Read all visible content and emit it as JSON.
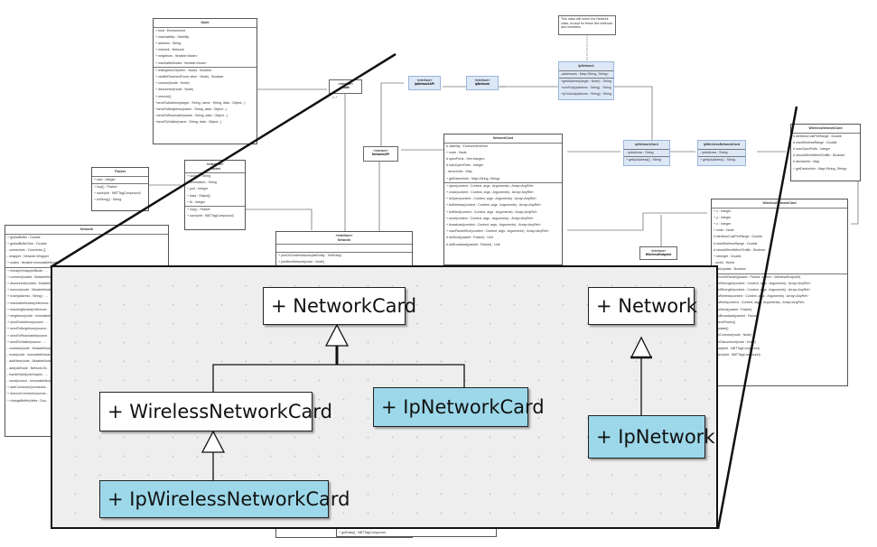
{
  "diagram": {
    "note": "This class will mirror the Network class, except for these few methods and members",
    "node": {
      "name": "Node",
      "attributes": [
        "+ host : Environment",
        "+ reachability : Visibility",
        "+ address : String",
        "+ network : Network",
        "+ neighbors : Iterable<Node>",
        "+ reachableNodes : Iterable<Node>"
      ],
      "methods": [
        "+ isNeighborOf(other : Node) : Boolean",
        "+ canBeReachedFrom( other : Node) : Boolean",
        "+ connect(node : Node)",
        "+ disconnect(node : Node)",
        "+ remove()",
        "+sendToAddress(target : String, name : String, data : Object...)",
        "+sendToNeighbors(name : String, data : Object...)",
        "+sendToReachable(name : String, data : Object...)",
        "+sendToVisible(name : String, data : Object...)"
      ]
    },
    "iface_node": {
      "stereotype": "«interface»",
      "name": "Node",
      "multiplicity": "1..*"
    },
    "ip_network_api": {
      "stereotype": "«interface»",
      "name": "IpNetworkAPI"
    },
    "ip_network_iface": {
      "stereotype": "«interface»",
      "name": "IpNetwork"
    },
    "network_api": {
      "stereotype": "«interface»",
      "name": "NetworkAPI"
    },
    "wireless_endpoint": {
      "stereotype": "«interface»",
      "name": "WirelessEndpoint"
    },
    "ip_network": {
      "name": "IpNetwork",
      "attributes": [
        "-addresses : Map<String, String>"
      ],
      "methods": [
        "+getAddress(target : Node) : String",
        "+uuidToIp(address : String) : String",
        "+ipToUuid(address : String) : String"
      ]
    },
    "network_card": {
      "name": "NetworkCard",
      "attributes": [
        "# visibility : EnvironmentHost",
        "+ node : Node",
        "# openPorts : Set<Integer>",
        "# maxOpenPorts : Integer",
        "- deviceInfo : Map",
        "+ getDeviceInfo : Map<String, String>"
      ],
      "methods": [
        "+ open(context : Context, args : Arguments) : Array<AnyRef>",
        "+ close(context : Context, args : Arguments) : Array<AnyRef>",
        "+ isOpen(context : Context, args : Arguments) : Array<AnyRef>",
        "+ isWireless(context : Context, args : Arguments) : Array<AnyRef>",
        "+ isWired(context : Context, args : Arguments) : Array<AnyRef>",
        "+ send(context : Context, args : Arguments) : Array<AnyRef>",
        "+ broadcast(context : Context, args : Arguments) : Array<AnyRef>",
        "+ maxPacketSize(context : Context, args : Arguments) : Array<AnyRef>",
        "# doSend(packet : Packet) : Unit",
        "# doBroadcast(packet : Packet) : Unit"
      ]
    },
    "ip_network_card": {
      "name": "IpNetworkCard",
      "attributes": [
        "- ipAddress : String"
      ],
      "methods": [
        "+ getIpAddress() : String"
      ]
    },
    "ip_wireless_network_card": {
      "name": "IpWirelessNetworkCard",
      "attributes": [
        "- ipAddress : String"
      ],
      "methods": [
        "+ getIpAddress() : String"
      ]
    },
    "wireless_network_card_small": {
      "name": "WirelessNetworkCard",
      "attributes": [
        "# wirelessCostPerRange : Double",
        "# maxWirelessRange : Double",
        "# maxOpenPorts : Integer",
        "# shouldSendWiredTraffic : Boolean",
        "# deviceInfo : Map",
        "+ getDeviceInfo : Map<String, String>"
      ]
    },
    "wireless_network_card": {
      "name": "WirelessNetworkCard",
      "attributes": [
        "+ x : Integer",
        "+ y : Integer",
        "+ z : Integer",
        "+ node : Node",
        "# wirelessCostPerRange : Double",
        "# maxWirelessRange : Double",
        "# shouldSendWiredTraffic : Boolean",
        "+ strength : Double",
        "- world : World",
        "- canUpdate : Boolean"
      ],
      "methods": [
        "+ receivePacket(packet : Packet, source : WirelessEndpoint)",
        "+ getStrength(context : Context, args : Arguments) : Array<AnyRef>",
        "+ setStrength(context : Context, args : Arguments) : Array<AnyRef>",
        "+ isWireless(context : Context, args : Arguments) : Array<AnyRef>",
        "+ isWired(context : Context, args : Arguments) : Array<AnyRef>",
        "# doSend(packet : Packet)",
        "# doBroadcast(packet : Packet)",
        "- checkPower()",
        "+ update()",
        "+ onConnect(node : Node)",
        "+ onDisconnect(node : Node)",
        "+ load(nbt : NBTTagCompound)",
        "+ save(nbt : NBTTagCompound)"
      ]
    },
    "packet": {
      "name": "Packet",
      "attributes": [
        "+ size : Integer"
      ],
      "methods": [
        "+ hop() : Packet",
        "+ save(nbt : NBTTagCompound)",
        "+ toString() : String"
      ]
    },
    "packet_iface": {
      "stereotype": "«interface»",
      "name": "Packet",
      "attributes": [
        "+ source : String",
        "+ destination : String",
        "+ port : Integer",
        "+ data : Object[]",
        "+ ttl : Integer"
      ],
      "methods": [
        "+ hop() : Packet",
        "+ save(nbt : NBTTagCompound)"
      ]
    },
    "network_iface": {
      "stereotype": "«interface»",
      "name": "Network",
      "methods": [
        "+ joinOrCreateNetwork(tileEntity : TileEntity)",
        "+ joinNewNetwork(node : Node)"
      ],
      "footer_method": "+ getData() : NBTTagCompound"
    },
    "network": {
      "name": "Network",
      "attributes": [
        "+ globalBuffer : Double",
        "+ globalBufferSize : Double",
        "- connectors : Connector []",
        "- wrapper : Network.Wrapper",
        "+ nodes : Iterable<ImmutableNode>"
      ],
      "methods": [
        "+ remap(remappedNode : ...",
        "+ connect(nodeA : MutableNode...",
        "+ disconnect(nodeA : MutableNode...",
        "+ remove(node : MutableNode...",
        "+ node(address : String) : ...",
        "+ reachableNodes(reference...",
        "+ reachingNodes(reference...",
        "+ neighbors(node : ImmutableNode...",
        "+ sendToAddress(source : ...",
        "+ sendToNeighbors(source...",
        "+ sendToReachable(source...",
        "+ sendToVisible(source : ...",
        "- contains(node : MutableNode...",
        "- node(node : ImmutableNode...",
        "- addNew(node : MutableNode...",
        "- add(oldNode : Network.W...",
        "- handleSplit(subGraphs : ...",
        "- send(source : ImmutableNode...",
        "+ addConnector(connector...",
        "+ removeConnector(conne...",
        "+ changeBuffer(delta : Dou..."
      ]
    }
  },
  "zoom": {
    "network_card": "+ NetworkCard",
    "wireless_network_card": "+ WirelessNetworkCard",
    "ip_network_card": "+ IpNetworkCard",
    "ip_wireless_network_card": "+ IpWirelessNetworkCard",
    "network": "+ Network",
    "ip_network": "+ IpNetwork"
  },
  "colors": {
    "highlight_cyan": "#9cd8e9",
    "interface_blue": "#dde8f7",
    "panel_bg": "#eeeeee"
  }
}
